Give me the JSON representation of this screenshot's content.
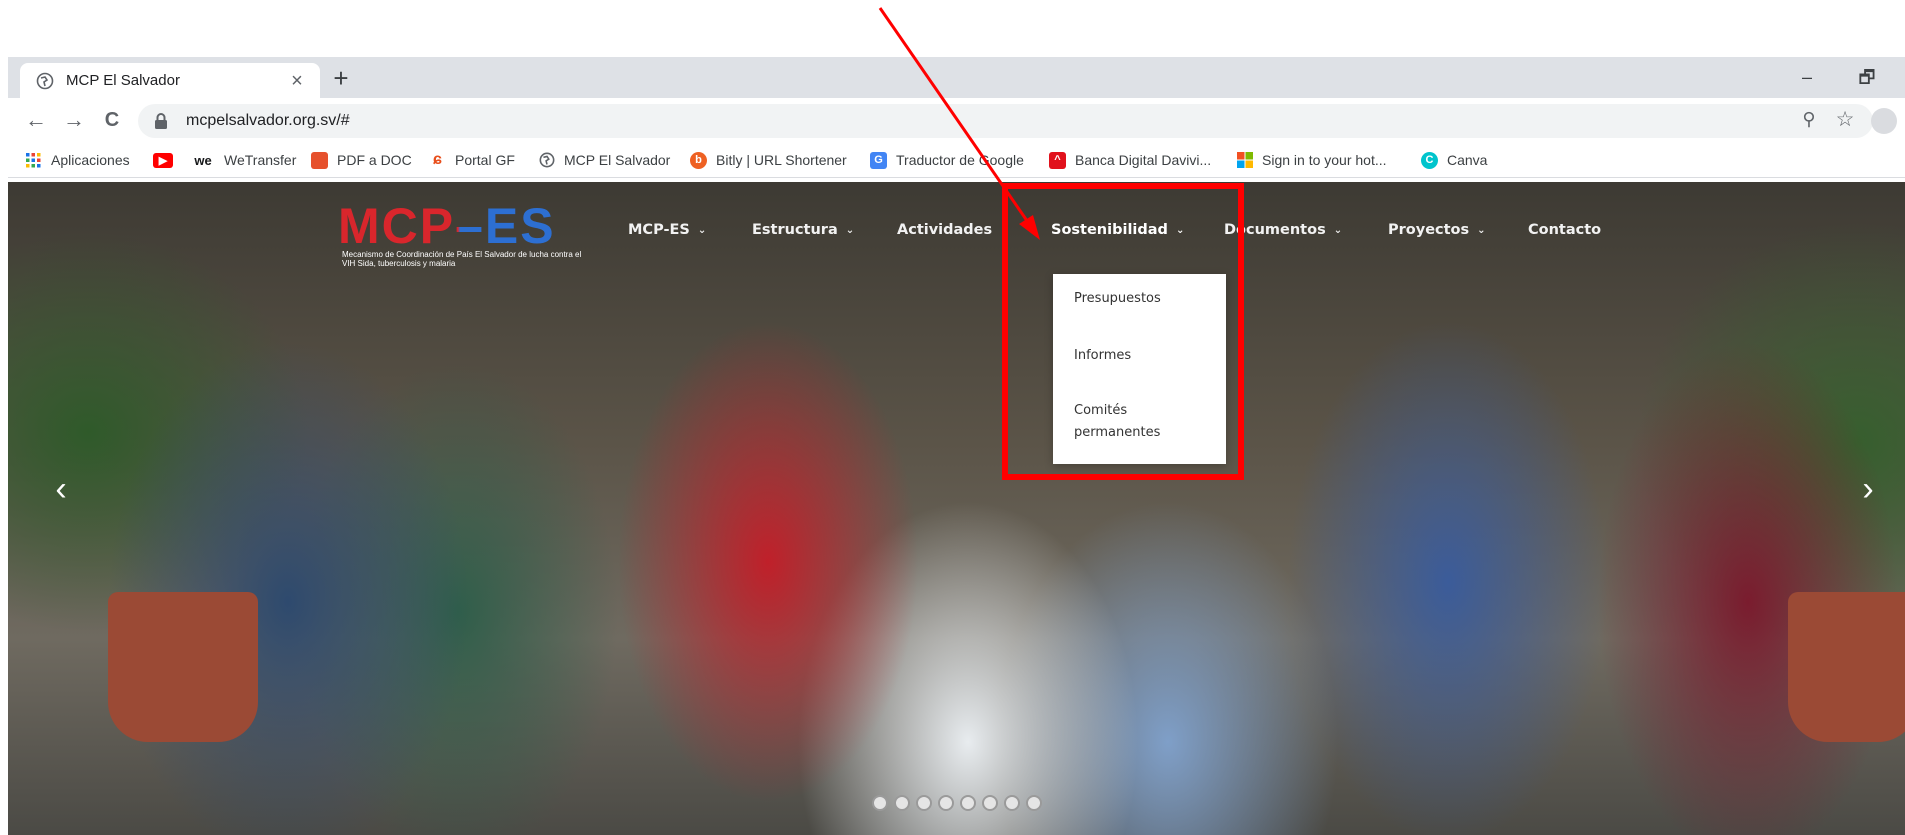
{
  "browser": {
    "tab": {
      "title": "MCP El Salvador",
      "close": "×"
    },
    "new_tab": "+",
    "window": {
      "minimize": "–",
      "restore": "🗗"
    },
    "nav": {
      "back": "←",
      "forward": "→",
      "reload": "C"
    },
    "url": "mcpelsalvador.org.sv/#",
    "zoom_icon": "⚲",
    "star_icon": "☆"
  },
  "bookmarks": [
    {
      "label": "Aplicaciones",
      "icon": "apps-icon",
      "color": "#1a73e8"
    },
    {
      "label": "",
      "icon": "youtube-icon",
      "color": "#ff0000"
    },
    {
      "label": "WeTransfer",
      "icon": "wetransfer-icon",
      "color": "#17181a"
    },
    {
      "label": "PDF a DOC",
      "icon": "pdf-icon",
      "color": "#e6512d"
    },
    {
      "label": "Portal GF",
      "icon": "portal-gf-icon",
      "color": "#e84e1b"
    },
    {
      "label": "MCP El Salvador",
      "icon": "globe-icon",
      "color": "#5f6368"
    },
    {
      "label": "Bitly | URL Shortener",
      "icon": "bitly-icon",
      "color": "#ee6123"
    },
    {
      "label": "Traductor de Google",
      "icon": "translate-icon",
      "color": "#4285f4"
    },
    {
      "label": "Banca Digital Davivi...",
      "icon": "davivienda-icon",
      "color": "#e1111c"
    },
    {
      "label": "Sign in to your hot...",
      "icon": "microsoft-icon",
      "color": "#f25022"
    },
    {
      "label": "Canva",
      "icon": "canva-icon",
      "color": "#00c4cc"
    }
  ],
  "site": {
    "logo": {
      "text": "MCP–ES",
      "subtitle": "Mecanismo de Coordinación de País El Salvador de lucha contra el VIH Sida, tuberculosis y malaria"
    },
    "menu": [
      {
        "label": "MCP-ES",
        "caret": "⌄"
      },
      {
        "label": "Estructura",
        "caret": "⌄"
      },
      {
        "label": "Actividades",
        "caret": "⌄"
      },
      {
        "label": "Sostenibilidad",
        "caret": "⌄"
      },
      {
        "label": "Documentos",
        "caret": "⌄"
      },
      {
        "label": "Proyectos",
        "caret": "⌄"
      },
      {
        "label": "Contacto",
        "caret": ""
      }
    ],
    "dropdown": [
      "Presupuestos",
      "Informes",
      "Comités permanentes"
    ],
    "slider": {
      "prev": "‹",
      "next": "›",
      "slide_count": 8
    }
  },
  "annotation": {
    "color": "#ff0000"
  }
}
